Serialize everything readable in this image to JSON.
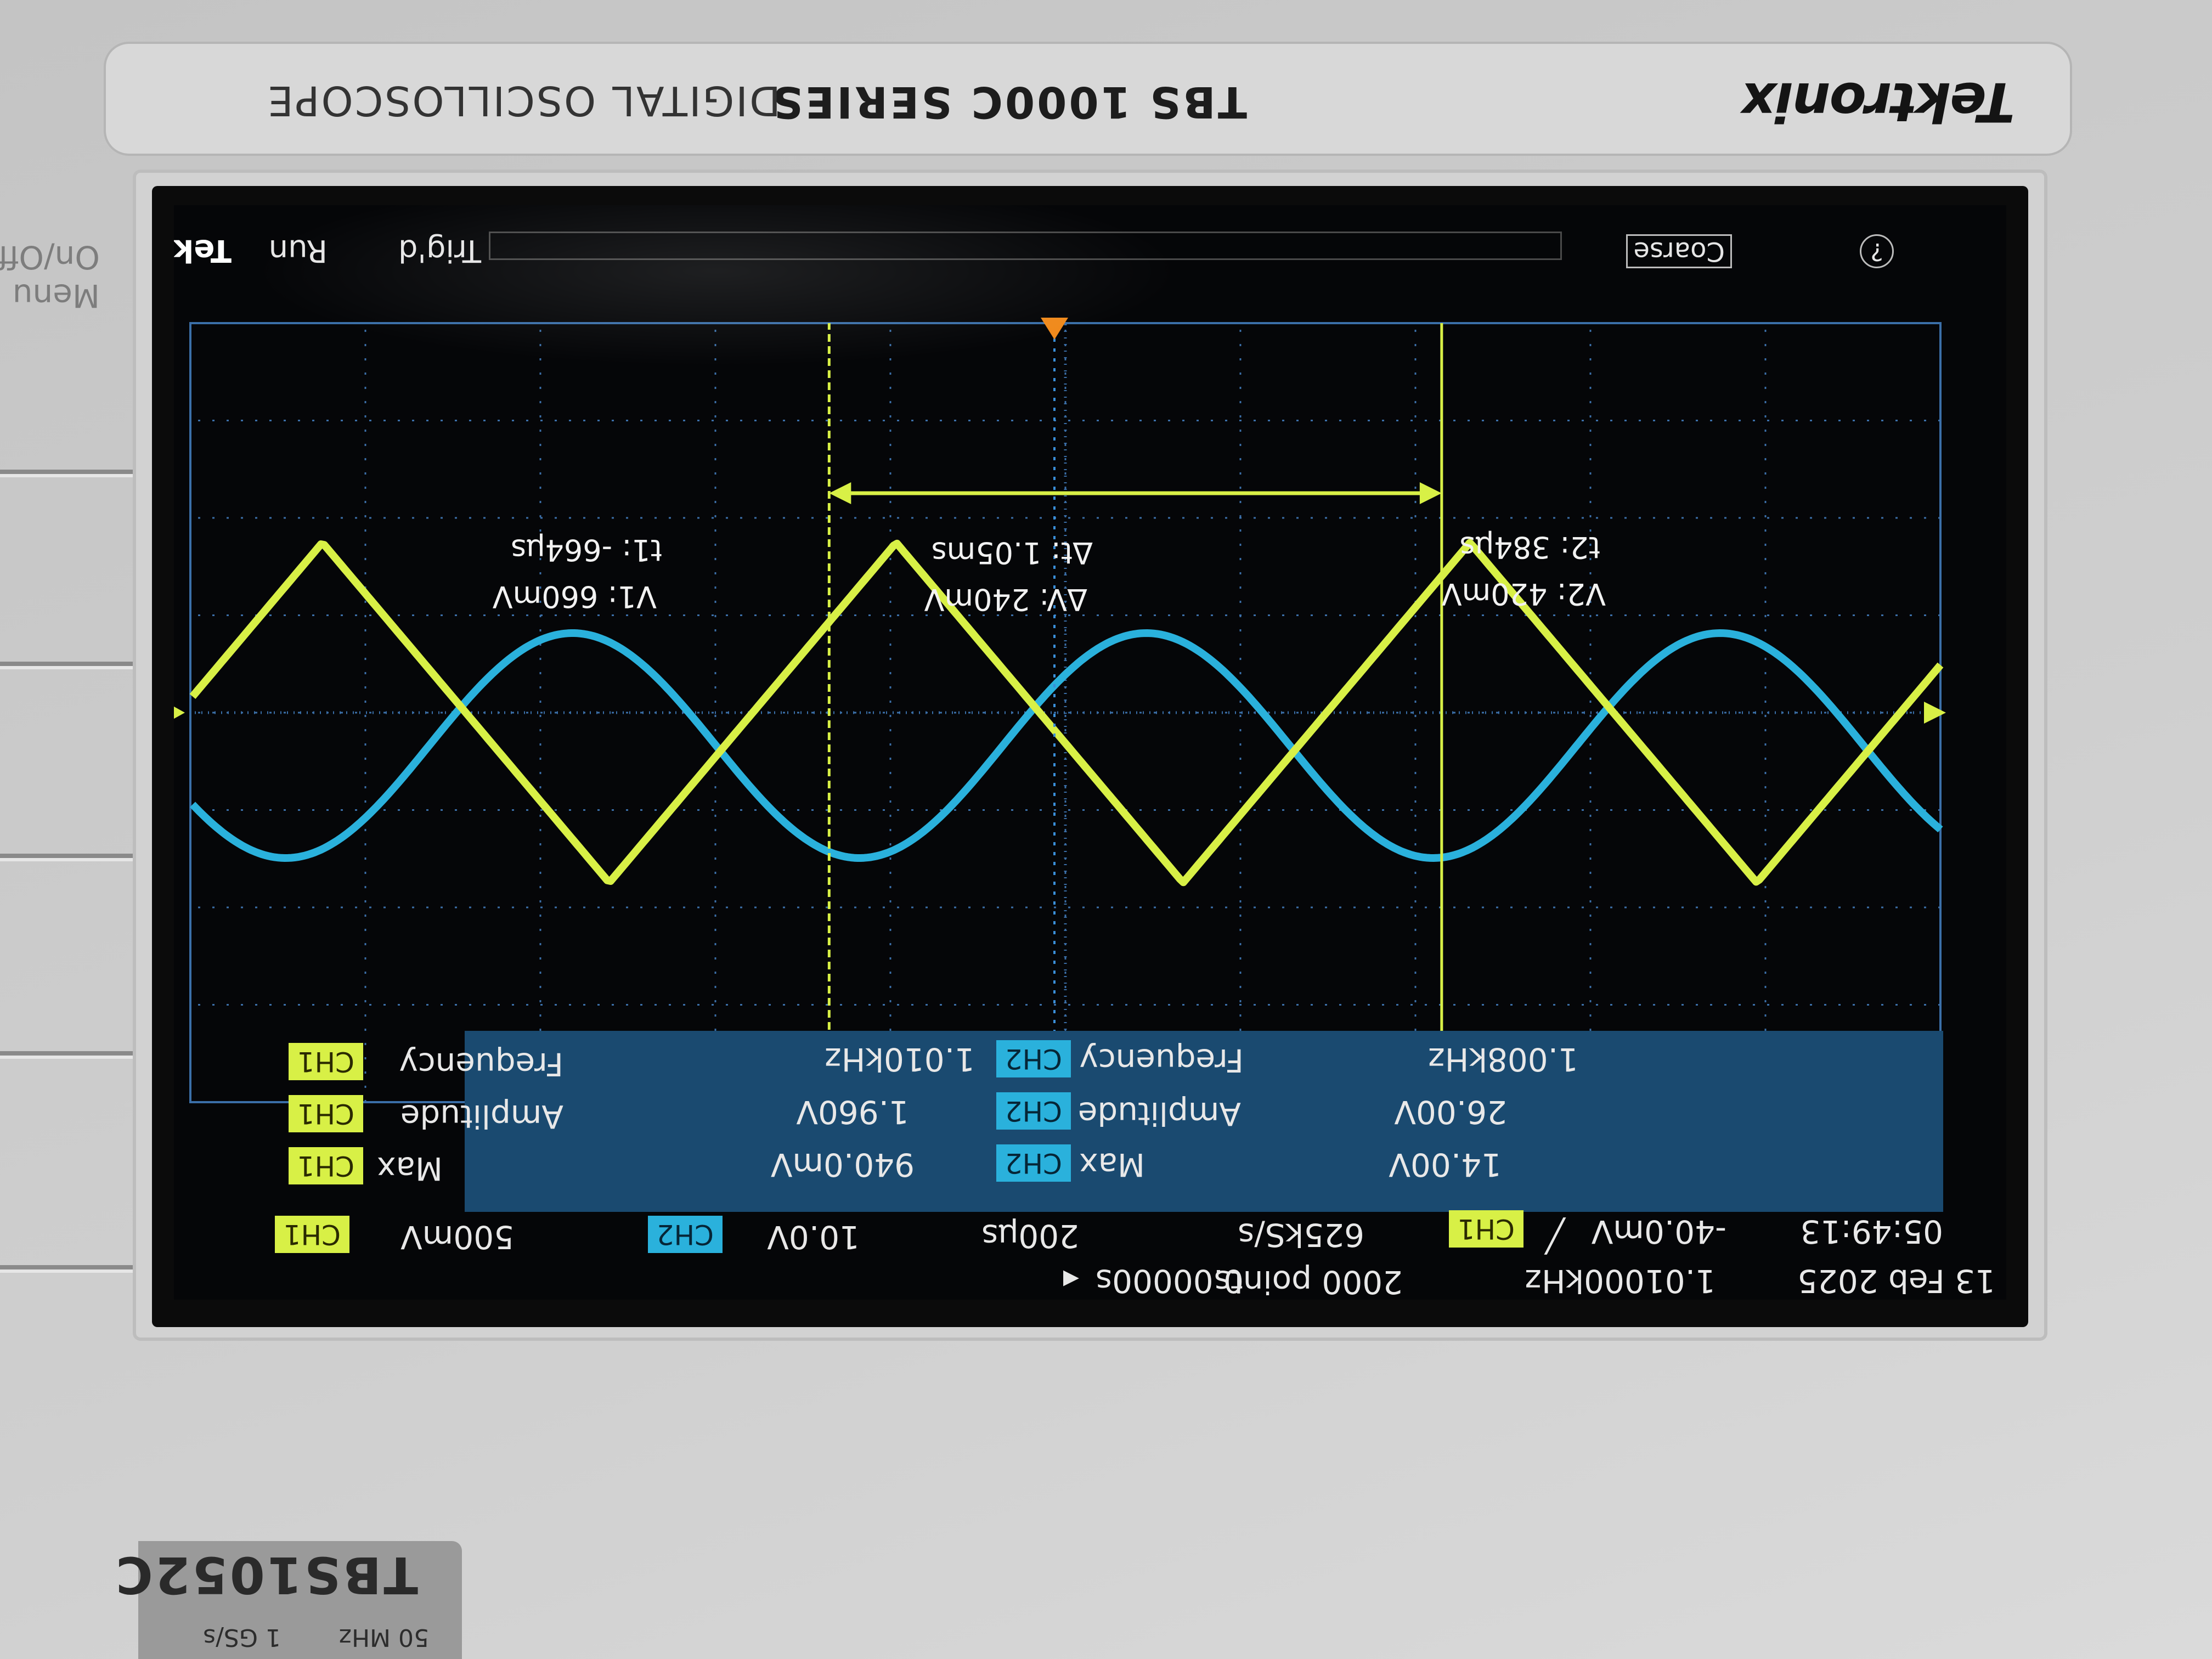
{
  "brand": "Tektronix",
  "series": "TBS 1000C SERIES",
  "series_sub": "DIGITAL OSCILLOSCOPE",
  "model": "TBS1052C",
  "model_specs": [
    "50 MHz",
    "1 GS/s"
  ],
  "menu_label": [
    "Menu",
    "On/Off"
  ],
  "header": {
    "ch1_label": "CH1",
    "ch1_scale": "500mV",
    "ch2_label": "CH2",
    "ch2_scale": "10.0V",
    "timebase": "200μs",
    "sample_rate": "625kS/s",
    "trigger_source": "CH1",
    "trigger_level": "-40.0mV",
    "time_position": "0.00000s",
    "record_length": "2000 points",
    "trigger_freq": "1.01000kHz",
    "date": "13 Feb 2025",
    "time": "05:49:13"
  },
  "measurements": {
    "ch1": [
      {
        "label": "Max",
        "value": "940.0mV"
      },
      {
        "label": "Amplitude",
        "value": "1.960V"
      },
      {
        "label": "Frequency",
        "value": "1.010kHz"
      }
    ],
    "ch2": [
      {
        "label": "Max",
        "value": "14.00V"
      },
      {
        "label": "Amplitude",
        "value": "26.00V"
      },
      {
        "label": "Frequency",
        "value": "1.008kHz"
      }
    ]
  },
  "cursors": {
    "t1": "t1: -664μs",
    "v1": "V1: 660mV",
    "dt": "Δt: 1.05ms",
    "dv": "ΔV: 240mV",
    "t2": "t2: 384μs",
    "v2": "V2: 420mV"
  },
  "status": {
    "brand_short": "Tek",
    "run_state": "Run",
    "trig_state": "Trig'd",
    "knob_mode": "Coarse",
    "help": "?"
  },
  "colors": {
    "ch1": "#d8f046",
    "ch2": "#2ab1dc",
    "grid": "#3b6fa8",
    "panel": "#1a4a70"
  }
}
